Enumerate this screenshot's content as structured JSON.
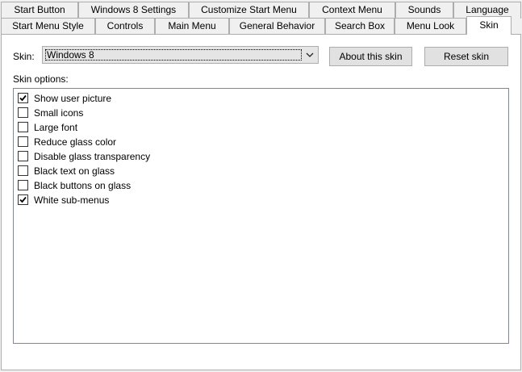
{
  "tabs_row1": [
    {
      "label": "Start Button"
    },
    {
      "label": "Windows 8 Settings"
    },
    {
      "label": "Customize Start Menu"
    },
    {
      "label": "Context Menu"
    },
    {
      "label": "Sounds"
    },
    {
      "label": "Language"
    }
  ],
  "tabs_row2": [
    {
      "label": "Start Menu Style"
    },
    {
      "label": "Controls"
    },
    {
      "label": "Main Menu"
    },
    {
      "label": "General Behavior"
    },
    {
      "label": "Search Box"
    },
    {
      "label": "Menu Look"
    },
    {
      "label": "Skin",
      "selected": true
    }
  ],
  "skin": {
    "label": "Skin:",
    "value": "Windows 8",
    "about_button": "About this skin",
    "reset_button": "Reset skin"
  },
  "skin_options": {
    "label": "Skin options:",
    "items": [
      {
        "label": "Show user picture",
        "checked": true
      },
      {
        "label": "Small icons",
        "checked": false
      },
      {
        "label": "Large font",
        "checked": false
      },
      {
        "label": "Reduce glass color",
        "checked": false
      },
      {
        "label": "Disable glass transparency",
        "checked": false
      },
      {
        "label": "Black text on glass",
        "checked": false
      },
      {
        "label": "Black buttons on glass",
        "checked": false
      },
      {
        "label": "White sub-menus",
        "checked": true
      }
    ]
  }
}
